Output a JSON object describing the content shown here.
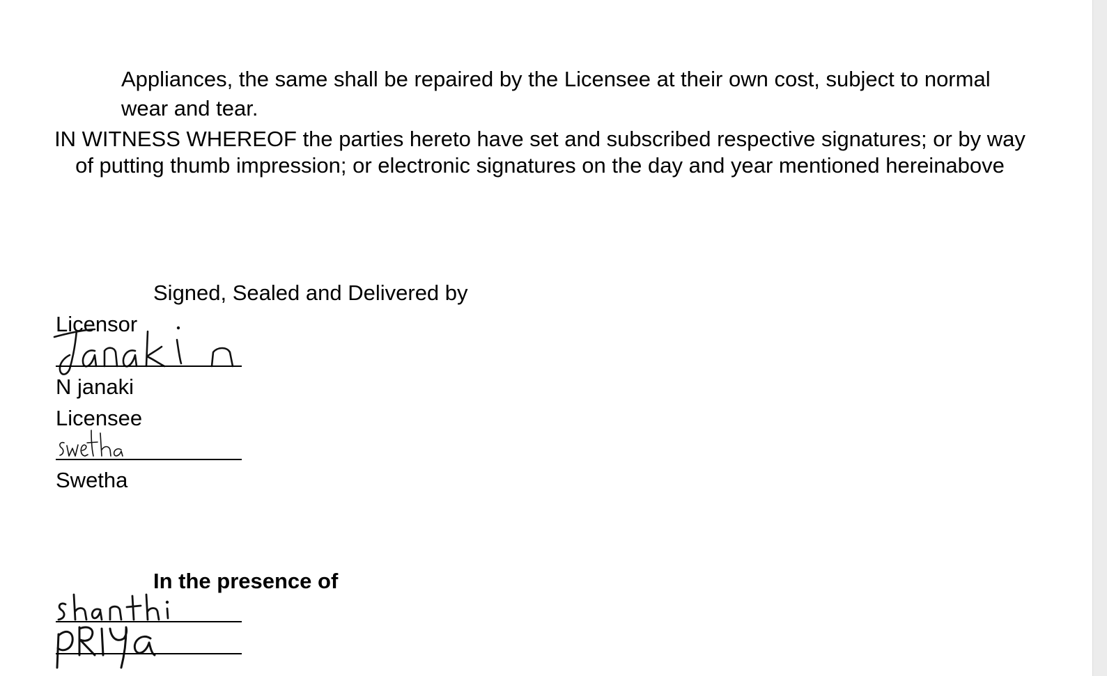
{
  "document": {
    "continued_clause": "Appliances, the same shall be repaired by the Licensee at their own cost, subject to normal wear and tear.",
    "witness_clause": "IN WITNESS WHEREOF the parties hereto have set and subscribed respective signatures; or by way of putting thumb impression; or electronic signatures on the day and year mentioned hereinabove"
  },
  "signing": {
    "heading": "Signed, Sealed and Delivered by",
    "licensor": {
      "role": "Licensor",
      "signature_text": "Janaki n",
      "name": "N janaki"
    },
    "licensee": {
      "role": "Licensee",
      "signature_text": "swetha",
      "name": "Swetha"
    }
  },
  "witnesses": {
    "heading": "In the presence of",
    "signatures": [
      {
        "signature_text": "shanthi"
      },
      {
        "signature_text": "pRIYa"
      }
    ]
  }
}
